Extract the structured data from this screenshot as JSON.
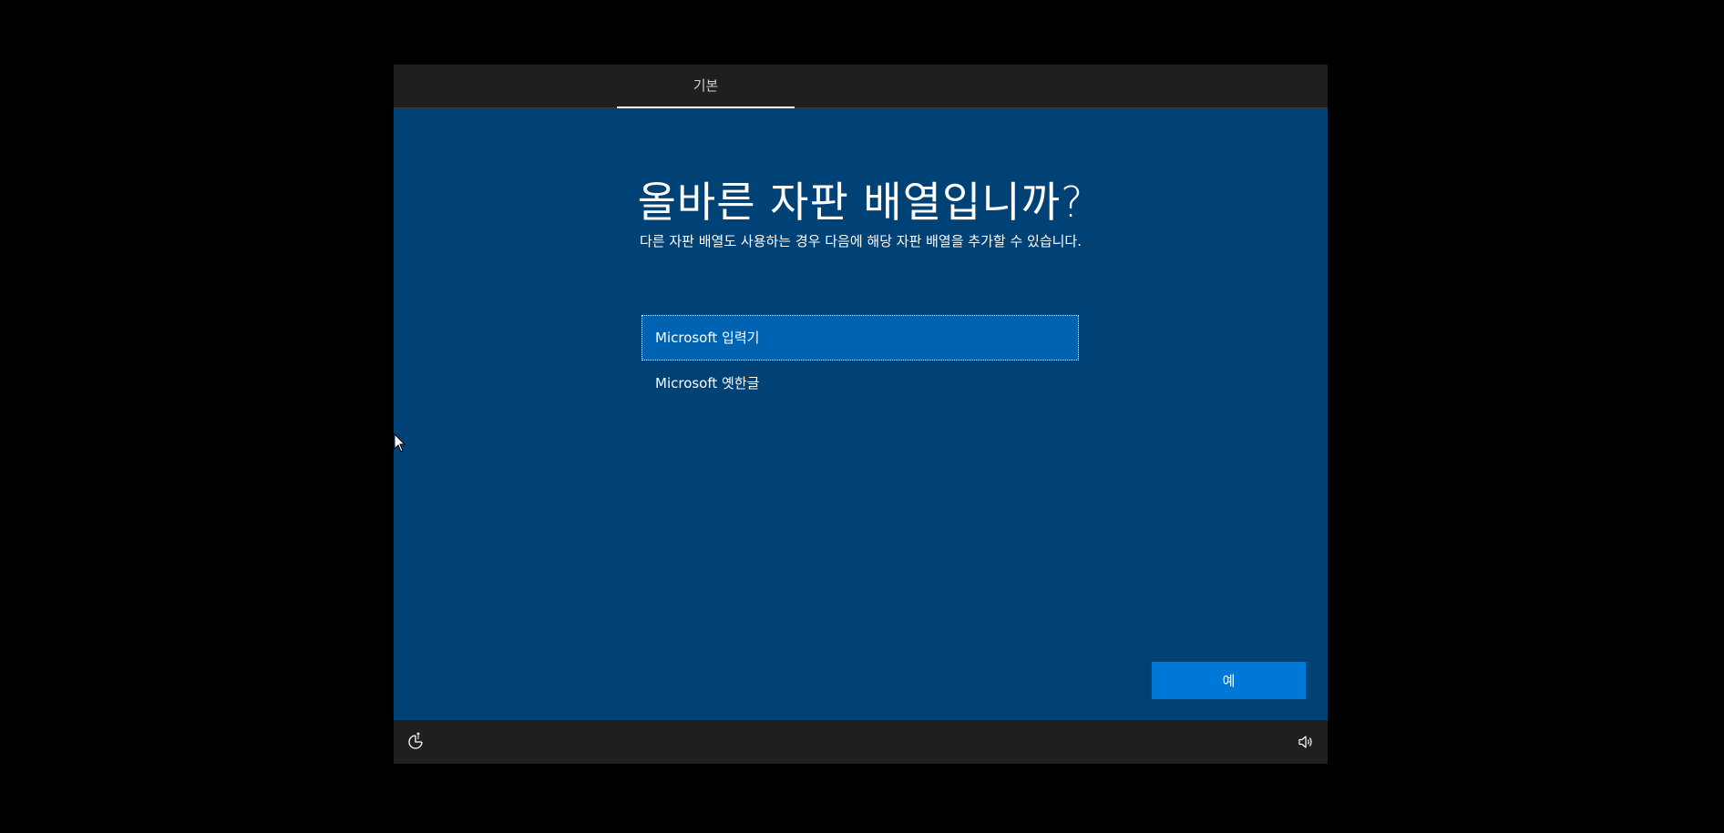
{
  "header": {
    "tab_label": "기본"
  },
  "main": {
    "title": "올바른 자판 배열입니까?",
    "subtitle": "다른 자판 배열도 사용하는 경우 다음에 해당 자판 배열을 추가할 수 있습니다.",
    "options": [
      {
        "label": "Microsoft 입력기",
        "selected": true
      },
      {
        "label": "Microsoft 옛한글",
        "selected": false
      }
    ],
    "confirm_label": "예"
  },
  "footer": {
    "left_icon": "accessibility-icon",
    "right_icon": "volume-icon"
  },
  "colors": {
    "background": "#004275",
    "bars": "#1f1f1f",
    "selected_option": "#0063b1",
    "button": "#0078d7"
  }
}
